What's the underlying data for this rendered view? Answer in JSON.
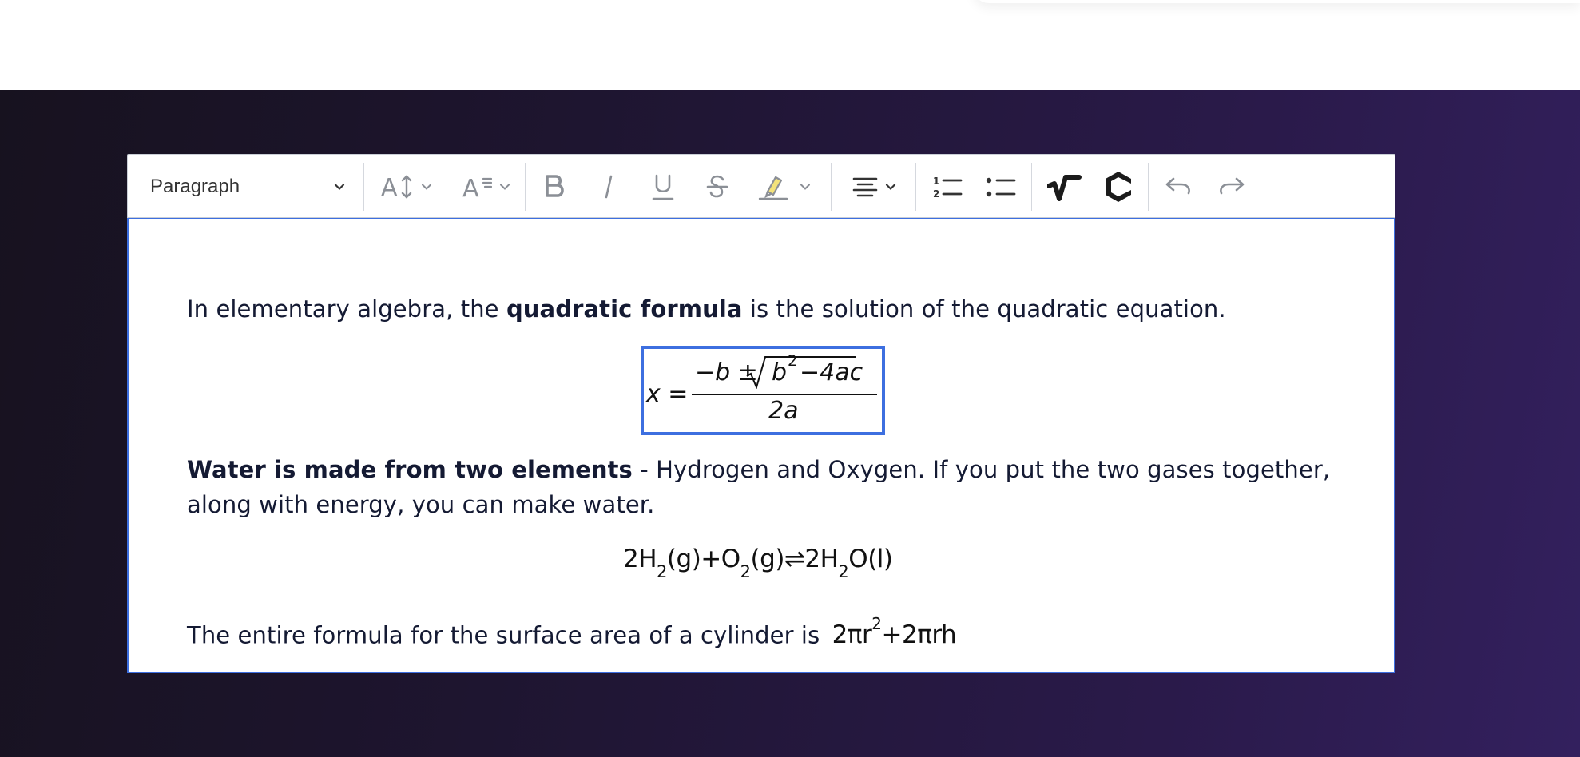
{
  "toolbar": {
    "paragraph_label": "Paragraph"
  },
  "content": {
    "p1_before": "In elementary algebra, the ",
    "p1_bold": "quadratic formula",
    "p1_after": " is the solution of the quadratic equation.",
    "formula": {
      "lhs": "x =",
      "numerator_minus_b": "−b ±",
      "b": "b",
      "exp": "2",
      "rest": "−4ac",
      "denominator": "2a"
    },
    "p2_bold": "Water is made from two elements",
    "p2_line1": " - Hydrogen and Oxygen. If you put the two gases together,",
    "p2_line2": "along with energy, you can make water.",
    "chem": {
      "a": "2H",
      "a_sub": "2",
      "b": "(g)+O",
      "b_sub": "2",
      "c": "(g)⇌2H",
      "c_sub": "2",
      "d": "O(l)"
    },
    "p3_text": "The entire formula for the surface area of a cylinder is ",
    "p3_formula_a": "2πr",
    "p3_formula_sup": "2",
    "p3_formula_b": "+2πrh"
  },
  "colors": {
    "accent": "#3d6fe0",
    "text": "#141a33",
    "icon": "#8b8f96",
    "background_start": "#17121f",
    "background_end": "#33205e"
  }
}
